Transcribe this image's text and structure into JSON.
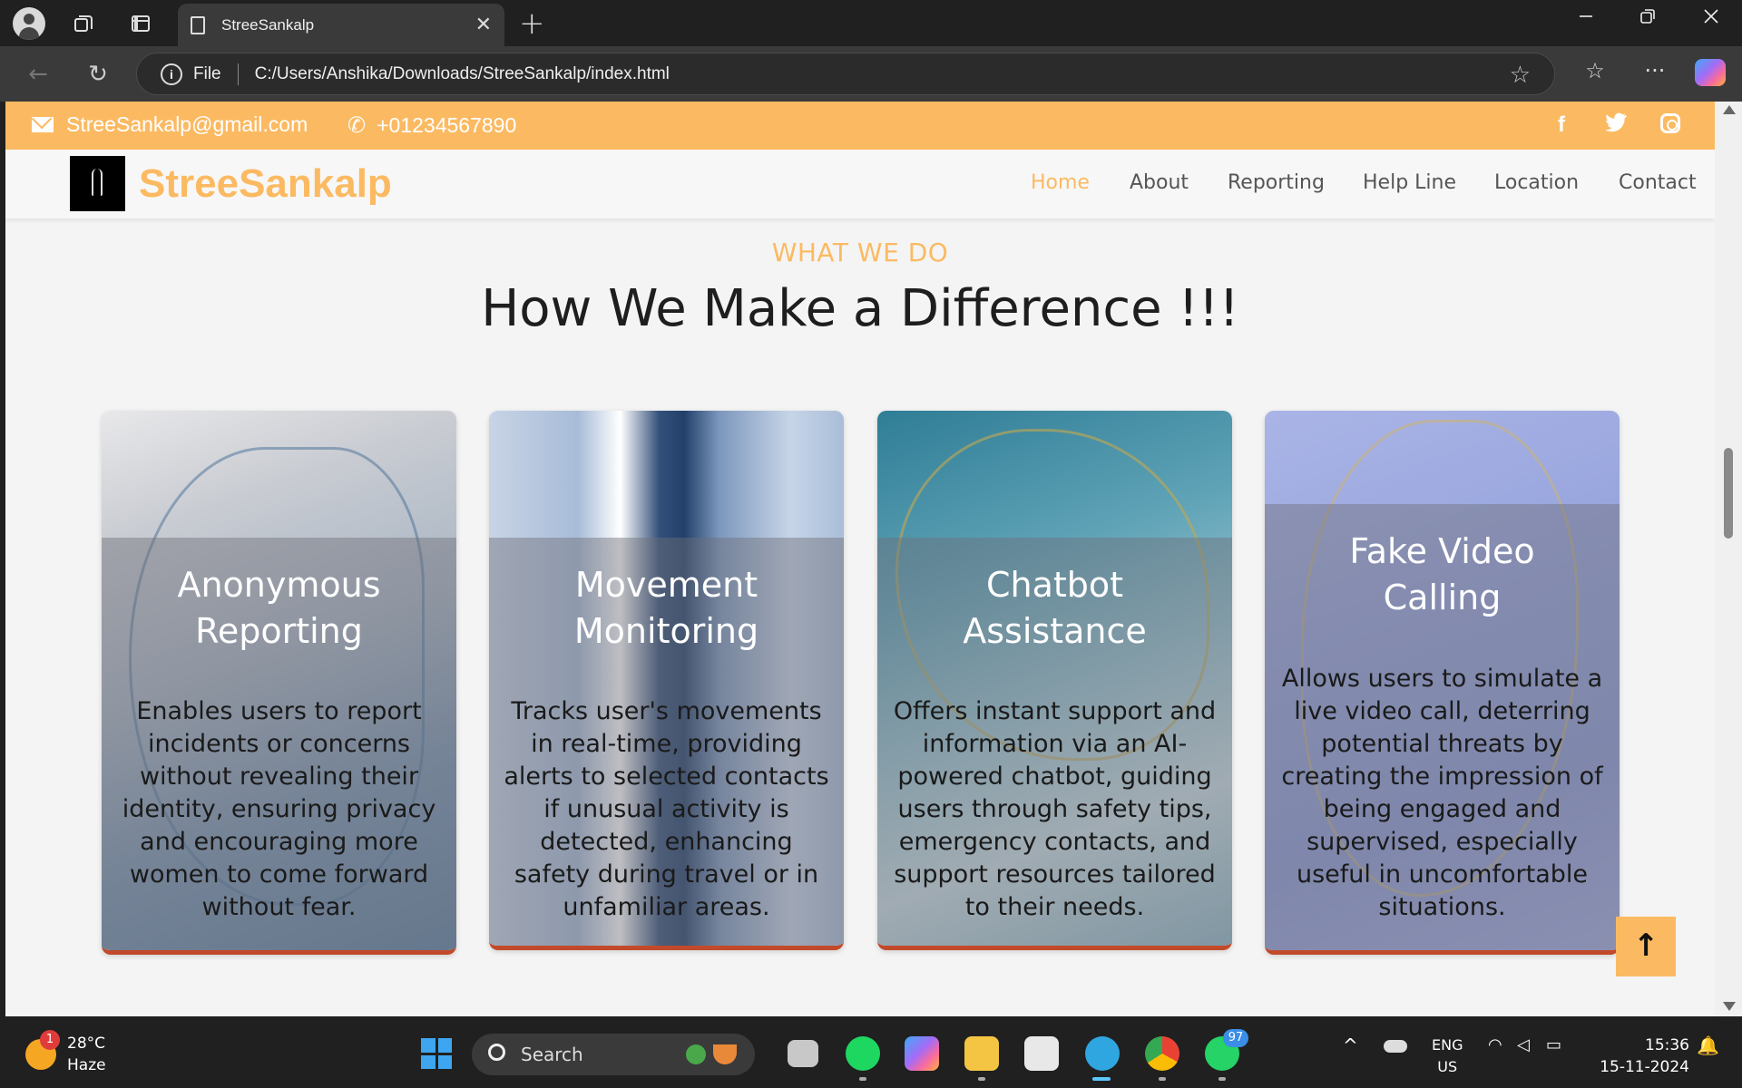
{
  "browser": {
    "tab_title": "StreeSankalp",
    "tab_close": "✕",
    "new_tab": "+",
    "url_scheme_label": "File",
    "url": "C:/Users/Anshika/Downloads/StreeSankalp/index.html",
    "icons": [
      "profile-icon",
      "workspaces-icon",
      "tab-actions-icon",
      "back-icon",
      "refresh-icon",
      "favorite-star-icon",
      "favorites-icon",
      "more-icon",
      "copilot-icon"
    ]
  },
  "site": {
    "contact": {
      "email": "StreeSankalp@gmail.com",
      "phone": "+01234567890"
    },
    "brand": "StreeSankalp",
    "nav": [
      "Home",
      "About",
      "Reporting",
      "Help Line",
      "Location",
      "Contact"
    ],
    "active_nav": "Home",
    "section": {
      "eyebrow": "WHAT WE DO",
      "heading": "How We Make a Difference !!!"
    },
    "cards": [
      {
        "title_line1": "Anonymous",
        "title_line2": "Reporting",
        "desc": "Enables users to report incidents or concerns without revealing their identity, ensuring privacy and encouraging more women to come forward without fear."
      },
      {
        "title_line1": "Movement",
        "title_line2": "Monitoring",
        "desc": "Tracks user's movements in real-time, providing alerts to selected contacts if unusual activity is detected, enhancing safety during travel or in unfamiliar areas."
      },
      {
        "title_line1": "Chatbot",
        "title_line2": "Assistance",
        "desc": "Offers instant support and information via an AI-powered chatbot, guiding users through safety tips, emergency contacts, and support resources tailored to their needs."
      },
      {
        "title_line1": "Fake Video",
        "title_line2": "Calling",
        "desc": "Allows users to simulate a live video call, deterring potential threats by creating the impression of being engaged and supervised, especially useful in uncomfortable situations."
      }
    ],
    "back_to_top": "↑",
    "colors": {
      "accent": "#fbba62",
      "card_border": "#c24a2a"
    }
  },
  "taskbar": {
    "weather_temp": "28°C",
    "weather_desc": "Haze",
    "weather_badge": "1",
    "search_label": "Search",
    "whatsapp_badge": "97",
    "lang_line1": "ENG",
    "lang_line2": "US",
    "time": "15:36",
    "date": "15-11-2024"
  }
}
